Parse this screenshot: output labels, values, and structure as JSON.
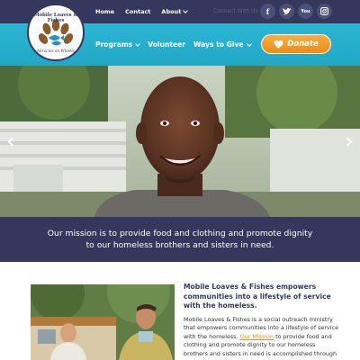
{
  "logo": {
    "title": "Mobile Loaves & Fishes",
    "tagline": "Miracles on Wheels"
  },
  "top_nav": [
    {
      "label": "Home",
      "has_dropdown": false
    },
    {
      "label": "Contact",
      "has_dropdown": false
    },
    {
      "label": "About",
      "has_dropdown": true
    }
  ],
  "social": {
    "label": "Connect With Us",
    "icons": [
      {
        "name": "facebook-icon",
        "glyph": "f"
      },
      {
        "name": "twitter-icon",
        "glyph": "t"
      },
      {
        "name": "youtube-icon",
        "glyph": "You"
      },
      {
        "name": "instagram-icon",
        "glyph": "◎"
      }
    ]
  },
  "main_nav": [
    {
      "label": "Programs",
      "has_dropdown": true
    },
    {
      "label": "Volunteer",
      "has_dropdown": false
    },
    {
      "label": "Ways to Give",
      "has_dropdown": true
    }
  ],
  "donate": {
    "label": "Donate"
  },
  "mission": {
    "text": "Our mission is to provide food and clothing and promote dignity to our homeless brothers and sisters in need."
  },
  "about": {
    "heading": "Mobile Loaves & Fishes empowers communities into a lifestyle of service with the homeless.",
    "body_before": "Mobile Loaves & Fishes is a social outreach ministry that empowers communities into a lifestyle of service with the homeless. ",
    "link": "Our Mission",
    "body_after": " to provide food and clothing and promote dignity to our homeless brothers and sisters in need is accomplished through our core programs."
  },
  "colors": {
    "navy": "#35385c",
    "teal": "#2cb6d4",
    "orange": "#ef8b14",
    "white": "#ffffff"
  }
}
